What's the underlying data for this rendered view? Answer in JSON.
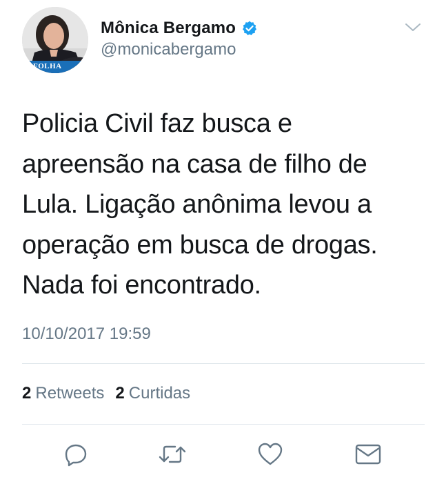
{
  "author": {
    "display_name": "Mônica Bergamo",
    "handle": "@monicabergamo",
    "avatar_badge": "FOLHA",
    "verified_icon": "verified-badge-icon"
  },
  "tweet": {
    "text": "Policia Civil faz busca e\napreensão na casa de filho de\nLula. Ligação anônima levou a\noperação em busca de drogas.\nNada foi encontrado.",
    "timestamp": "10/10/2017 19:59"
  },
  "stats": {
    "retweets_count": "2",
    "retweets_label": "Retweets",
    "likes_count": "2",
    "likes_label": "Curtidas"
  },
  "actions": {
    "reply_icon": "reply-icon",
    "retweet_icon": "retweet-icon",
    "like_icon": "heart-icon",
    "dm_icon": "envelope-icon"
  },
  "colors": {
    "text": "#14171a",
    "secondary": "#657786",
    "divider": "#e1e8ed",
    "verified": "#1da1f2",
    "icon": "#657786"
  }
}
